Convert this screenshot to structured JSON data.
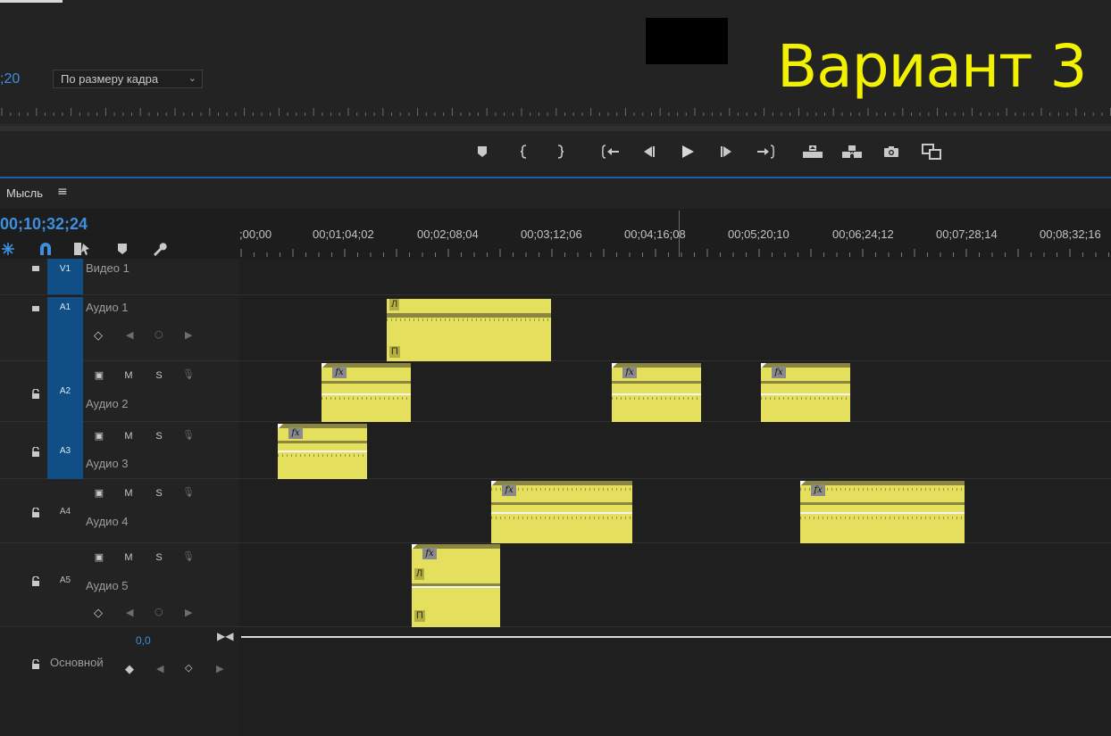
{
  "overlay": {
    "title": "Вариант 3"
  },
  "monitor": {
    "timecode": ";20",
    "zoom_label": "По размеру кадра"
  },
  "transport": [
    {
      "name": "add-marker-icon"
    },
    {
      "name": "mark-in-icon"
    },
    {
      "name": "mark-out-icon"
    },
    {
      "name": "go-to-in-icon"
    },
    {
      "name": "step-back-icon"
    },
    {
      "name": "play-icon"
    },
    {
      "name": "step-forward-icon"
    },
    {
      "name": "go-to-out-icon"
    },
    {
      "name": "lift-icon"
    },
    {
      "name": "extract-icon"
    },
    {
      "name": "export-frame-icon"
    },
    {
      "name": "compare-view-icon"
    }
  ],
  "timeline": {
    "sequence_name": "Мысль",
    "timecode": "00;10;32;24",
    "ruler_labels": [
      ";00;00",
      "00;01;04;02",
      "00;02;08;04",
      "00;03;12;06",
      "00;04;16;08",
      "00;05;20;10",
      "00;06;24;12",
      "00;07;28;14",
      "00;08;32;16"
    ],
    "tools": [
      "nest-icon",
      "snap-icon",
      "linked-selection-icon",
      "add-marker-icon",
      "settings-wrench-icon"
    ],
    "master": {
      "name": "Основной",
      "volume": "0,0"
    },
    "channel_labels": {
      "left": "Л",
      "right": "П"
    },
    "fx_label": "fx",
    "tracks": [
      {
        "id": "V1",
        "name": "Видео 1"
      },
      {
        "id": "A1",
        "name": "Аудио 1"
      },
      {
        "id": "A2",
        "name": "Аудио 2",
        "m": "M",
        "s": "S"
      },
      {
        "id": "A3",
        "name": "Аудио 3",
        "m": "M",
        "s": "S"
      },
      {
        "id": "A4",
        "name": "Аудио 4",
        "m": "M",
        "s": "S"
      },
      {
        "id": "A5",
        "name": "Аудио 5",
        "m": "M",
        "s": "S"
      }
    ]
  }
}
